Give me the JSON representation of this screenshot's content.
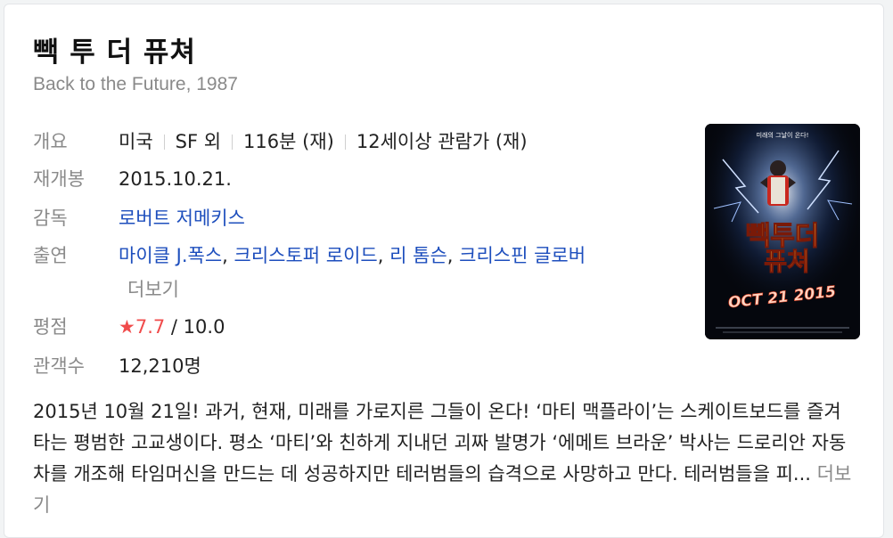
{
  "title": "빽 투 더 퓨쳐",
  "original_title": "Back to the Future, 1987",
  "info": {
    "overview_label": "개요",
    "country": "미국",
    "genre": "SF 외",
    "runtime": "116분 (재)",
    "rating_age": "12세이상 관람가 (재)",
    "rerelease_label": "재개봉",
    "rerelease_date": "2015.10.21.",
    "director_label": "감독",
    "director": "로버트 저메키스",
    "cast_label": "출연",
    "cast": [
      "마이클 J.폭스",
      "크리스토퍼 로이드",
      "리 톰슨",
      "크리스핀 글로버"
    ],
    "cast_more": "더보기",
    "score_label": "평점",
    "score_star": "★",
    "score": "7.7",
    "score_max": "/ 10.0",
    "audience_label": "관객수",
    "audience": "12,210명"
  },
  "synopsis": {
    "text": "2015년 10월 21일! 과거, 현재, 미래를 가로지른 그들이 온다! ‘마티 맥플라이’는 스케이트보드를 즐겨 타는 평범한 고교생이다. 평소 ‘마티’와 친하게 지내던 괴짜 발명가 ‘에메트 브라운’ 박사는 드로리안 자동차를 개조해 타임머신을 만드는 데 성공하지만 테러범들의 습격으로 사망하고 만다. 테러범들을 피...",
    "more": "더보기"
  },
  "poster": {
    "tagline": "미래의 그날이 온다!",
    "logo_line1": "빽투더",
    "logo_line2": "퓨쳐",
    "date_text": "OCT 21 2015",
    "accent": "#f2a31b"
  },
  "colors": {
    "link": "#1d4ebd",
    "rating": "#f04b4b",
    "muted": "#8a8a8a"
  }
}
